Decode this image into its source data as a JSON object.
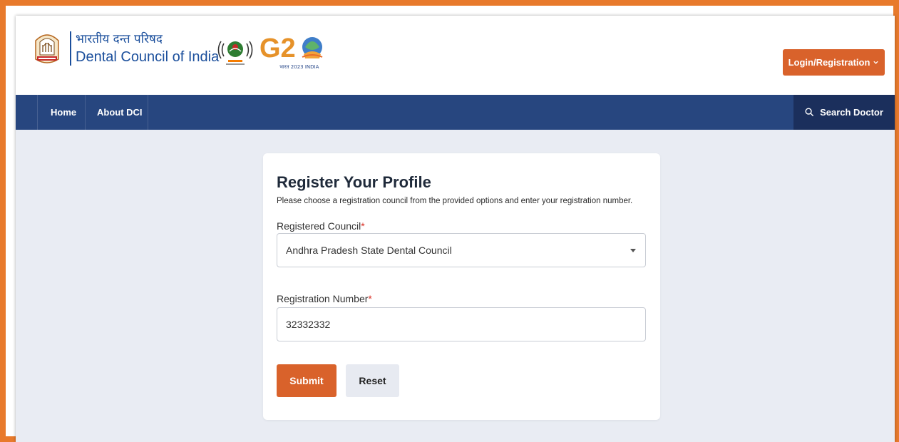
{
  "header": {
    "org_name_hindi": "भारतीय दन्त परिषद",
    "org_name_english": "Dental Council of India",
    "login_button": "Login/Registration",
    "login_icon": "chevron-down-icon",
    "logo_text": "G20",
    "logo_tagline": "भारत 2023 INDIA"
  },
  "nav": {
    "items": [
      {
        "label": "Home"
      },
      {
        "label": "About DCI"
      }
    ],
    "search_label": "Search Doctor",
    "search_icon": "search-icon"
  },
  "form": {
    "title": "Register Your Profile",
    "subtitle": "Please choose a registration council from the provided options and enter your registration number.",
    "council_label": "Registered Council",
    "council_value": "Andhra Pradesh State Dental Council",
    "regnum_label": "Registration Number",
    "regnum_value": "32332332",
    "required_marker": "*",
    "submit_label": "Submit",
    "reset_label": "Reset"
  },
  "colors": {
    "frame_border": "#e87a2c",
    "brand_blue": "#1b4f9c",
    "navbar": "#27467f",
    "search_bg": "#1b2f5c",
    "accent_orange": "#d9622b",
    "page_bg": "#e9ecf3"
  }
}
